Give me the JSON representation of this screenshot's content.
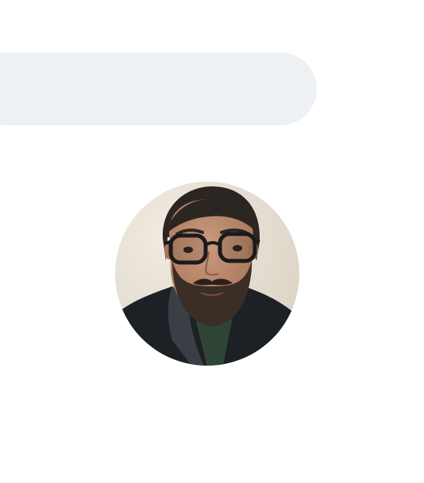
{
  "search_bar": {
    "value": "",
    "placeholder": ""
  },
  "avatar": {
    "icon": "profile-photo",
    "colors": {
      "wall": "#e9e2d7",
      "skin": "#b98a6f",
      "hair": "#2b2622",
      "beard": "#3a2e27",
      "jacket": "#1f2226",
      "shirt": "#2e4536"
    }
  }
}
